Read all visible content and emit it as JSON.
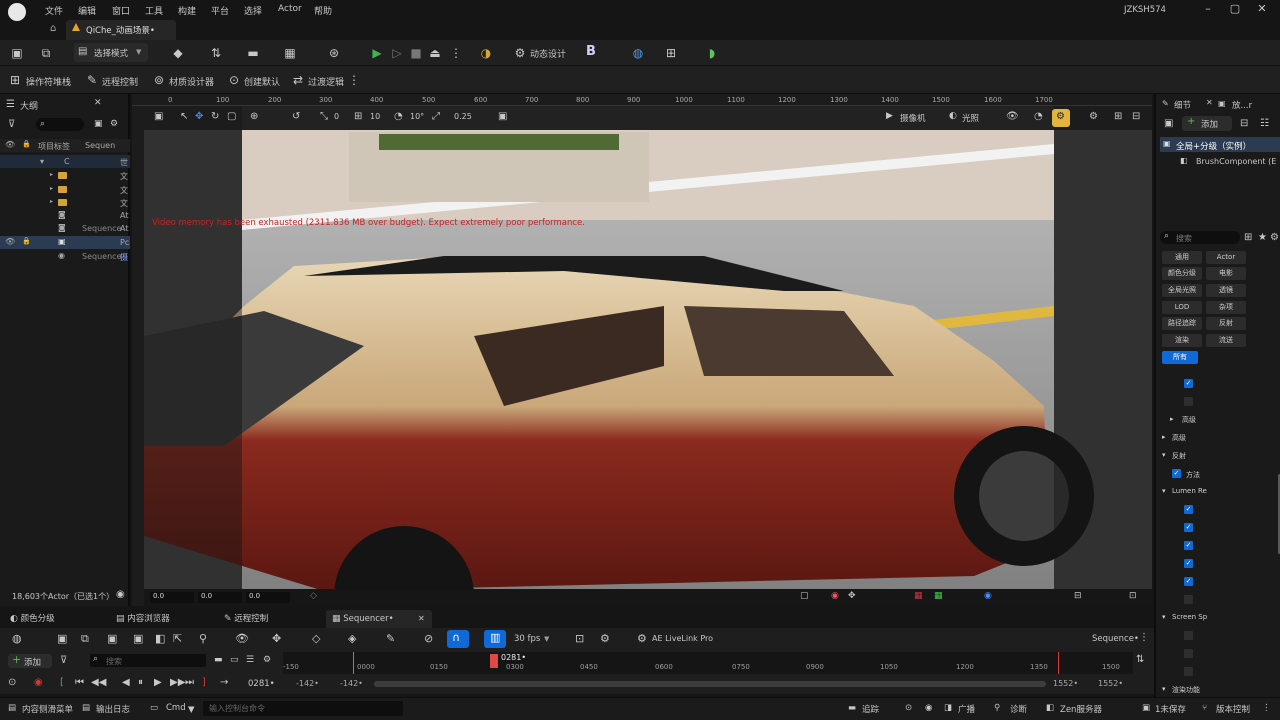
{
  "titlebar": {
    "menu": [
      "文件",
      "编辑",
      "窗口",
      "工具",
      "构建",
      "平台",
      "选择",
      "Actor",
      "帮助"
    ],
    "user": "JZKSH574",
    "doc_tab": "QiChe_动画场景•"
  },
  "toolbar": {
    "mode_label": "选择模式",
    "animation_design_label": "动态设计",
    "blueprint_label": "B"
  },
  "toolbar2": {
    "items": [
      "操作符堆栈",
      "远程控制",
      "材质设计器",
      "创建默认",
      "过渡逻辑"
    ]
  },
  "outliner": {
    "title": "大纲",
    "header_label": "项目标签",
    "header_col2": "Sequen",
    "rows": [
      {
        "label": "C",
        "suffix": "世"
      },
      {
        "label": "",
        "suffix": "文"
      },
      {
        "label": "",
        "suffix": "文"
      },
      {
        "label": "",
        "suffix": "文"
      },
      {
        "label": "",
        "suffix": "At"
      },
      {
        "label": "Sequence",
        "suffix": "At"
      },
      {
        "label": "",
        "suffix": "Pc"
      },
      {
        "label": "Sequence",
        "suffix": "摄"
      }
    ],
    "actor_count": "18,603个Actor（已选1个）"
  },
  "viewport": {
    "ruler": [
      "0",
      "100",
      "200",
      "300",
      "400",
      "500",
      "600",
      "700",
      "800",
      "900",
      "1000",
      "1100",
      "1200",
      "1300",
      "1400",
      "1500",
      "1600",
      "1700"
    ],
    "snap_angle": "0",
    "grid_size": "10",
    "rotation_snap": "10°",
    "scale_snap": "0.25",
    "camera_label": "摄像机",
    "lighting_label": "光照",
    "warning": "Video memory has been exhausted (2311.836 MB over budget). Expect extremely poor performance.",
    "coords": [
      "0.0",
      "0.0",
      "0.0"
    ]
  },
  "details": {
    "tab1": "细节",
    "tab2": "放...r",
    "add_label": "添加",
    "instance_label": "全局+分级（实例）",
    "component_label": "BrushComponent (E",
    "search_placeholder": "搜索",
    "filters": [
      "通用",
      "Actor",
      "颜色分级",
      "电影",
      "全局光照",
      "透镜",
      "LOD",
      "杂项",
      "路径追踪",
      "反射",
      "渲染",
      "流送",
      "所有"
    ],
    "sections": [
      "高级",
      "高级",
      "反射",
      "方法",
      "Lumen Re",
      "Screen Sp",
      "渲染功能"
    ]
  },
  "bottom_tabs": [
    "颜色分级",
    "内容浏览器",
    "远程控制",
    "Sequencer•"
  ],
  "sequencer": {
    "add_label": "添加",
    "search_placeholder": "搜索",
    "fps": "30 fps",
    "livelink": "AE LiveLink Pro",
    "sequence_label": "Sequence•",
    "current_frame": "0281•",
    "frame_field": "0281•",
    "range_start": "-142•",
    "range_start2": "-142•",
    "range_end": "1552•",
    "range_end2": "1552•",
    "ticks": [
      "-150",
      "0000",
      "0150",
      "0300",
      "0450",
      "0600",
      "0750",
      "0900",
      "1050",
      "1200",
      "1350",
      "1500"
    ]
  },
  "statusbar": {
    "content_drawer": "内容侧滑菜单",
    "output_log": "输出日志",
    "cmd": "Cmd",
    "console_placeholder": "输入控制台命令",
    "trace": "追踪",
    "broadcast": "广播",
    "diagnose": "诊断",
    "zen": "Zen服务器",
    "unsaved": "1未保存",
    "version": "版本控制"
  }
}
